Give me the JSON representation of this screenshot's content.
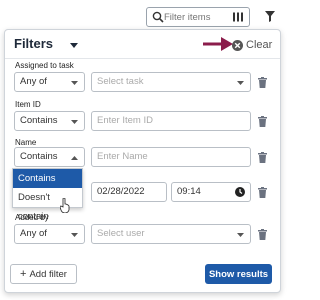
{
  "toolbar": {
    "search_placeholder": "Filter items",
    "icons": [
      "search-icon",
      "columns-icon",
      "filter-icon"
    ]
  },
  "panel": {
    "title": "Filters",
    "clear_label": "Clear",
    "accent_color": "#8b1c4b",
    "filters": [
      {
        "label": "Assigned to task",
        "operator": "Any of",
        "value_placeholder": "Select task"
      },
      {
        "label": "Item ID",
        "operator": "Contains",
        "value_placeholder": "Enter Item ID"
      },
      {
        "label": "Name",
        "operator": "Contains",
        "value_placeholder": "Enter Name"
      },
      {
        "date": "02/28/2022",
        "time": "09:14"
      },
      {
        "label": "Added by",
        "operator": "Any of",
        "value_placeholder": "Select user"
      }
    ],
    "operator_dropdown": {
      "options": [
        "Contains",
        "Doesn't contain"
      ],
      "highlighted": "Contains"
    },
    "add_filter_label": "Add filter",
    "show_results_label": "Show results",
    "primary_color": "#1e5aa8"
  }
}
